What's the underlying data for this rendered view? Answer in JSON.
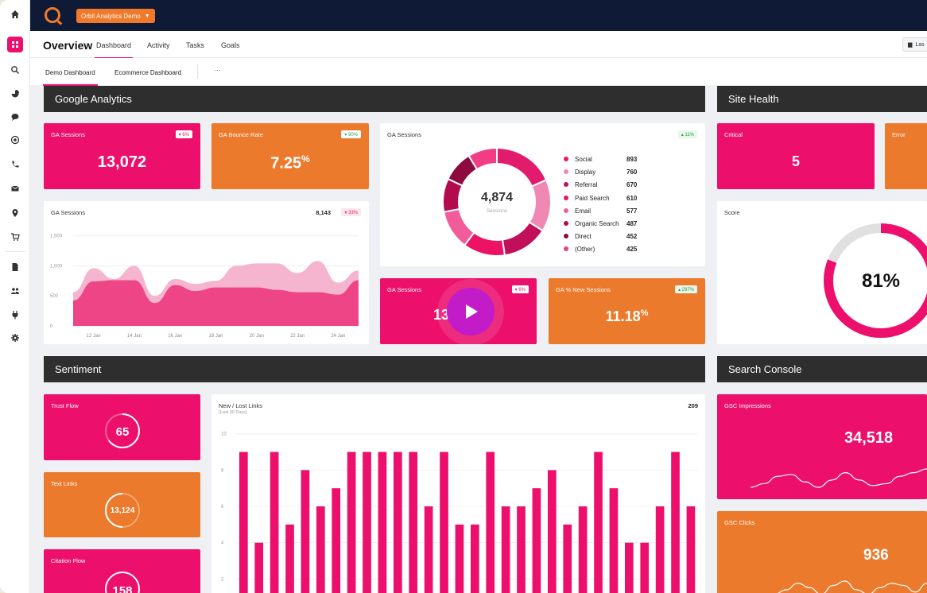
{
  "topbar": {
    "org_button": "Orbit Analytics Demo"
  },
  "nav": {
    "title": "Overview",
    "tabs": [
      "Dashboard",
      "Activity",
      "Tasks",
      "Goals"
    ],
    "date_button": "Las"
  },
  "subnav": {
    "tabs": [
      "Demo Dashboard",
      "Ecommerce Dashboard"
    ],
    "more": "···"
  },
  "sections": {
    "google_analytics": "Google Analytics",
    "site_health": "Site Health",
    "sentiment": "Sentiment",
    "search_console": "Search Console"
  },
  "ga": {
    "sessions_card": {
      "label": "GA Sessions",
      "value": "13,072",
      "badge": "▾ 6%"
    },
    "bounce_card": {
      "label": "GA Bounce Rate",
      "value": "7.25",
      "unit": "%",
      "badge": "▾ 90%"
    },
    "sessions_chart": {
      "label": "GA Sessions",
      "total": "8,143",
      "badge": "▾ 33%"
    },
    "donut": {
      "label": "GA Sessions",
      "badge": "▴ 11%",
      "total": "4,874",
      "sublabel": "Sessions"
    },
    "video_card": {
      "label": "GA Sessions",
      "badge": "▾ 6%",
      "value": "13"
    },
    "new_sessions_card": {
      "label": "GA % New Sessions",
      "badge": "▴ 297%",
      "value": "11.18",
      "unit": "%"
    }
  },
  "site_health": {
    "critical": {
      "label": "Critical",
      "value": "5"
    },
    "error": {
      "label": "Error"
    },
    "score": {
      "label": "Score",
      "value": "81%"
    }
  },
  "sentiment": {
    "trust_flow": {
      "label": "Trust Flow",
      "value": "65"
    },
    "text_links": {
      "label": "Text Links",
      "value": "13,124"
    },
    "citation_flow": {
      "label": "Citation Flow",
      "value": "158"
    },
    "links_chart": {
      "label": "New / Lost Links",
      "sublabel": "(Last 30 Days)",
      "total": "209"
    }
  },
  "search_console": {
    "impressions": {
      "label": "GSC Impressions",
      "value": "34,518"
    },
    "clicks": {
      "label": "GSC Clicks",
      "value": "936"
    }
  },
  "chart_data": [
    {
      "type": "area",
      "title": "GA Sessions",
      "x": [
        "11 Jan",
        "12 Jan",
        "13 Jan",
        "14 Jan",
        "15 Jan",
        "16 Jan",
        "17 Jan",
        "18 Jan",
        "19 Jan",
        "20 Jan",
        "21 Jan",
        "22 Jan",
        "23 Jan",
        "24 Jan",
        "25 Jan"
      ],
      "xticks": [
        "12 Jan",
        "14 Jan",
        "16 Jan",
        "18 Jan",
        "20 Jan",
        "22 Jan",
        "24 Jan"
      ],
      "yticks": [
        "1,500",
        "1,000",
        "500",
        "0"
      ],
      "ylim": [
        0,
        1600
      ],
      "series": [
        {
          "values": [
            560,
            960,
            780,
            1000,
            500,
            780,
            700,
            750,
            1000,
            1040,
            1040,
            880,
            1080,
            720,
            920
          ],
          "color": "#f5a8c7"
        },
        {
          "values": [
            420,
            740,
            760,
            760,
            380,
            680,
            580,
            640,
            640,
            640,
            600,
            560,
            560,
            520,
            760
          ],
          "color": "#ec3f82"
        }
      ]
    },
    {
      "type": "pie",
      "title": "GA Sessions",
      "categories": [
        "Social",
        "Display",
        "Referral",
        "Paid Search",
        "Email",
        "Organic Search",
        "Direct",
        "(Other)"
      ],
      "values": [
        893,
        760,
        670,
        610,
        577,
        487,
        452,
        425
      ],
      "colors": [
        "#e21b6c",
        "#f088b4",
        "#c20f59",
        "#ec1264",
        "#f25c9a",
        "#b30c4e",
        "#8c0a3d",
        "#f03d84"
      ]
    },
    {
      "type": "bar",
      "title": "New / Lost Links",
      "yticks": [
        "10",
        "8",
        "6",
        "4",
        "2"
      ],
      "ylim": [
        0,
        10.6
      ],
      "values": [
        9,
        4,
        9,
        5,
        8,
        6,
        7,
        9,
        9,
        9,
        9,
        9,
        6,
        9,
        5,
        5,
        9,
        6,
        6,
        7,
        8,
        5,
        6,
        9,
        7,
        4,
        4,
        6,
        9,
        6
      ]
    },
    {
      "type": "line",
      "title": "GSC Impressions",
      "values": [
        6,
        10,
        18,
        20,
        12,
        6,
        14,
        22,
        14,
        8,
        10,
        18,
        22,
        26
      ]
    },
    {
      "type": "line",
      "title": "GSC Clicks",
      "values": [
        4,
        8,
        14,
        10,
        4,
        12,
        16,
        8,
        4,
        10,
        14,
        12,
        6,
        14
      ]
    }
  ]
}
